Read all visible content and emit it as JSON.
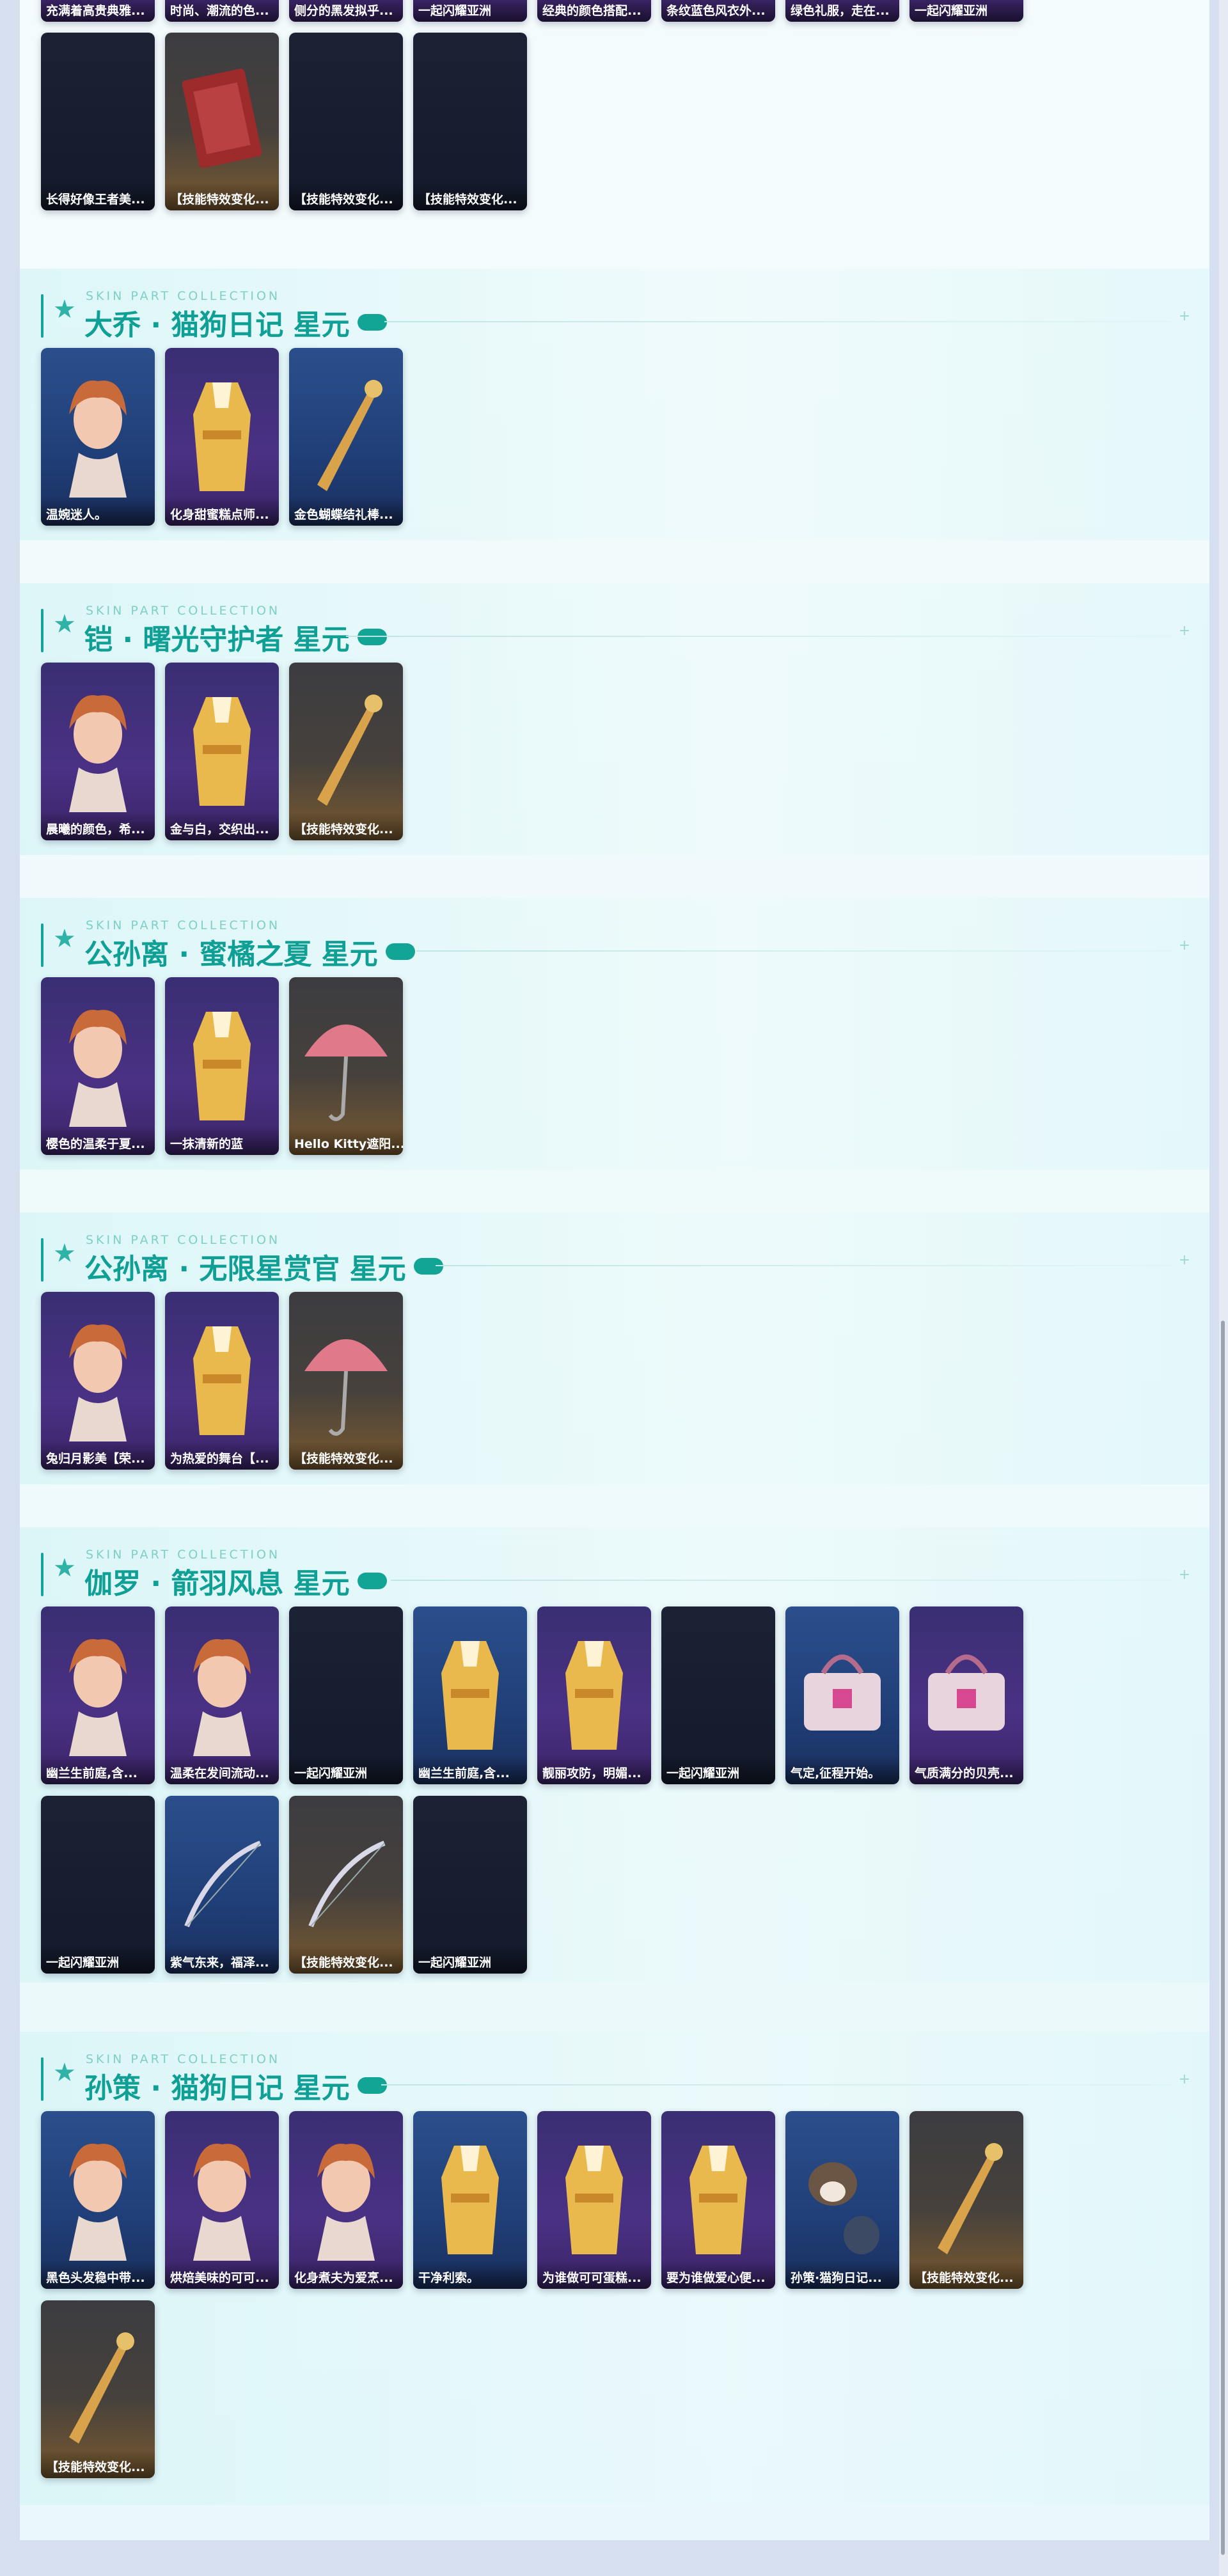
{
  "collection_subtitle": "SKIN PART COLLECTION",
  "top_partial_row": [
    "充满着高贵典雅...",
    "时尚、潮流的色...",
    "侧分的黑发拟乎...",
    "一起闪耀亚洲",
    "经典的颜色搭配...",
    "条纹蓝色风衣外...",
    "绿色礼服，走在...",
    "一起闪耀亚洲"
  ],
  "top_row": [
    {
      "label": "长得好像王者美...",
      "style": "dark"
    },
    {
      "label": "【技能特效变化...",
      "style": "gold",
      "icon": "book-icon"
    },
    {
      "label": "【技能特效变化...",
      "style": "dark"
    },
    {
      "label": "【技能特效变化...",
      "style": "dark"
    }
  ],
  "sections": [
    {
      "title": "大乔 · 猫狗日记 星元",
      "cards": [
        {
          "label": "温婉迷人。",
          "style": "blue",
          "icon": "hero-head-icon"
        },
        {
          "label": "化身甜蜜糕点师...",
          "style": "purple",
          "icon": "outfit-icon"
        },
        {
          "label": "金色蝴蝶结礼棒...",
          "style": "blue",
          "icon": "weapon-icon"
        }
      ]
    },
    {
      "title": "铠 · 曙光守护者 星元",
      "cards": [
        {
          "label": "晨曦的颜色，希...",
          "style": "purple",
          "icon": "hero-head-icon"
        },
        {
          "label": "金与白，交织出...",
          "style": "purple",
          "icon": "outfit-icon"
        },
        {
          "label": "【技能特效变化...",
          "style": "gold",
          "icon": "weapon-icon"
        }
      ]
    },
    {
      "title": "公孙离 · 蜜橘之夏 星元",
      "cards": [
        {
          "label": "樱色的温柔于夏...",
          "style": "purple",
          "icon": "hero-head-icon"
        },
        {
          "label": "一抹清新的蓝",
          "style": "purple",
          "icon": "outfit-icon"
        },
        {
          "label": "Hello Kitty遮阳...",
          "style": "gold",
          "icon": "umbrella-icon"
        }
      ]
    },
    {
      "title": "公孙离 · 无限星赏官 星元",
      "cards": [
        {
          "label": "兔归月影美【荣...",
          "style": "purple",
          "icon": "hero-head-icon"
        },
        {
          "label": "为热爱的舞台【...",
          "style": "purple",
          "icon": "outfit-icon"
        },
        {
          "label": "【技能特效变化...",
          "style": "gold",
          "icon": "umbrella-icon"
        }
      ]
    },
    {
      "title": "伽罗 · 箭羽风息 星元",
      "cards": [
        {
          "label": "幽兰生前庭,含...",
          "style": "purple",
          "icon": "hero-head-icon"
        },
        {
          "label": "温柔在发间流动...",
          "style": "purple",
          "icon": "hero-head-icon"
        },
        {
          "label": "一起闪耀亚洲",
          "style": "dark"
        },
        {
          "label": "幽兰生前庭,含...",
          "style": "blue",
          "icon": "outfit-icon"
        },
        {
          "label": "靓丽攻防，明媚...",
          "style": "purple",
          "icon": "outfit-icon"
        },
        {
          "label": "一起闪耀亚洲",
          "style": "dark"
        },
        {
          "label": "气定,征程开始。",
          "style": "blue",
          "icon": "bag-icon"
        },
        {
          "label": "气质满分的贝壳...",
          "style": "purple",
          "icon": "bag-icon"
        },
        {
          "label": "一起闪耀亚洲",
          "style": "dark"
        },
        {
          "label": "紫气东来，福泽...",
          "style": "blue",
          "icon": "bow-icon"
        },
        {
          "label": "【技能特效变化...",
          "style": "gold",
          "icon": "bow-icon"
        },
        {
          "label": "一起闪耀亚洲",
          "style": "dark"
        }
      ]
    },
    {
      "title": "孙策 · 猫狗日记 星元",
      "cards": [
        {
          "label": "黑色头发稳中带...",
          "style": "blue",
          "icon": "hero-head-icon"
        },
        {
          "label": "烘焙美味的可可...",
          "style": "purple",
          "icon": "hero-head-icon"
        },
        {
          "label": "化身煮夫为爱烹...",
          "style": "purple",
          "icon": "hero-head-icon"
        },
        {
          "label": "干净利索。",
          "style": "blue",
          "icon": "outfit-icon"
        },
        {
          "label": "为谁做可可蛋糕...",
          "style": "purple",
          "icon": "outfit-icon"
        },
        {
          "label": "要为谁做爱心便...",
          "style": "purple",
          "icon": "outfit-icon"
        },
        {
          "label": "孙策·猫狗日记...",
          "style": "blue",
          "icon": "pet-icon"
        },
        {
          "label": "【技能特效变化...",
          "style": "gold",
          "icon": "weapon-icon"
        },
        {
          "label": "【技能特效变化...",
          "style": "gold",
          "icon": "weapon-icon"
        }
      ]
    }
  ]
}
